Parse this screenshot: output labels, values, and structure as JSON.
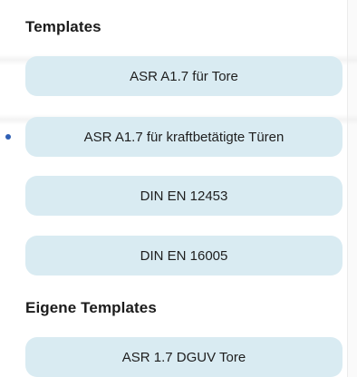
{
  "sections": [
    {
      "title": "Templates",
      "items": [
        {
          "label": "ASR A1.7 für Tore"
        },
        {
          "label": "ASR A1.7 für kraftbetätigte Türen"
        },
        {
          "label": "DIN EN 12453"
        },
        {
          "label": "DIN EN 16005"
        }
      ]
    },
    {
      "title": "Eigene Templates",
      "items": [
        {
          "label": "ASR 1.7 DGUV Tore"
        }
      ]
    }
  ],
  "colors": {
    "button_background": "#d9ebf2",
    "selection_dot": "#2f5fb4",
    "text": "#1e1e1e"
  }
}
